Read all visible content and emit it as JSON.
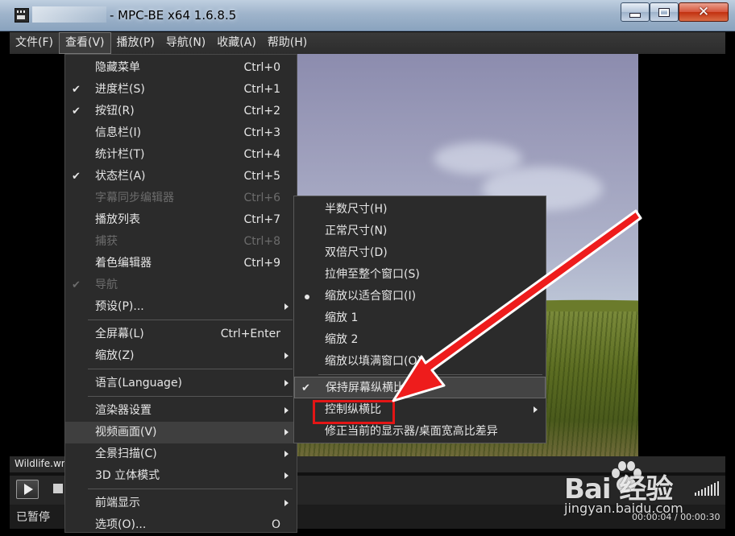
{
  "window": {
    "title": "- MPC-BE x64 1.6.8.5",
    "minimize_glyph": "",
    "close_glyph": "✕"
  },
  "menubar": [
    {
      "label": "文件(F)"
    },
    {
      "label": "查看(V)",
      "active": true
    },
    {
      "label": "播放(P)"
    },
    {
      "label": "导航(N)"
    },
    {
      "label": "收藏(A)"
    },
    {
      "label": "帮助(H)"
    }
  ],
  "view_menu": {
    "items": [
      {
        "label": "隐藏菜单",
        "shortcut": "Ctrl+0",
        "checked": false,
        "enabled": true
      },
      {
        "label": "进度栏(S)",
        "shortcut": "Ctrl+1",
        "checked": true,
        "enabled": true
      },
      {
        "label": "按钮(R)",
        "shortcut": "Ctrl+2",
        "checked": true,
        "enabled": true
      },
      {
        "label": "信息栏(I)",
        "shortcut": "Ctrl+3",
        "checked": false,
        "enabled": true
      },
      {
        "label": "统计栏(T)",
        "shortcut": "Ctrl+4",
        "checked": false,
        "enabled": true
      },
      {
        "label": "状态栏(A)",
        "shortcut": "Ctrl+5",
        "checked": true,
        "enabled": true
      },
      {
        "label": "字幕同步编辑器",
        "shortcut": "Ctrl+6",
        "checked": false,
        "enabled": false
      },
      {
        "label": "播放列表",
        "shortcut": "Ctrl+7",
        "checked": false,
        "enabled": true
      },
      {
        "label": "捕获",
        "shortcut": "Ctrl+8",
        "checked": false,
        "enabled": false
      },
      {
        "label": "着色编辑器",
        "shortcut": "Ctrl+9",
        "checked": false,
        "enabled": true
      },
      {
        "label": "导航",
        "shortcut": "",
        "checked": true,
        "enabled": false
      },
      {
        "label": "预设(P)...",
        "shortcut": "",
        "submenu": true,
        "enabled": true
      },
      {
        "label": "全屏幕(L)",
        "shortcut": "Ctrl+Enter",
        "enabled": true
      },
      {
        "label": "缩放(Z)",
        "shortcut": "",
        "submenu": true,
        "enabled": true
      },
      {
        "label": "语言(Language)",
        "shortcut": "",
        "submenu": true,
        "enabled": true
      },
      {
        "label": "渲染器设置",
        "shortcut": "",
        "submenu": true,
        "enabled": true
      },
      {
        "label": "视频画面(V)",
        "shortcut": "",
        "submenu": true,
        "enabled": true,
        "highlighted": true
      },
      {
        "label": "全景扫描(C)",
        "shortcut": "",
        "submenu": true,
        "enabled": true
      },
      {
        "label": "3D 立体模式",
        "shortcut": "",
        "submenu": true,
        "enabled": true
      },
      {
        "label": "前端显示",
        "shortcut": "",
        "submenu": true,
        "enabled": true
      },
      {
        "label": "选项(O)...",
        "shortcut": "O",
        "enabled": true
      }
    ]
  },
  "video_frame_submenu": {
    "items": [
      {
        "label": "半数尺寸(H)"
      },
      {
        "label": "正常尺寸(N)"
      },
      {
        "label": "双倍尺寸(D)"
      },
      {
        "label": "拉伸至整个窗口(S)"
      },
      {
        "label": "缩放以适合窗口(I)",
        "selected": true
      },
      {
        "label": "缩放 1"
      },
      {
        "label": "缩放 2"
      },
      {
        "label": "缩放以填满窗口(O)"
      },
      {
        "label": "保持屏幕纵横比(K)",
        "checked": true,
        "highlighted": true
      },
      {
        "label": "控制纵横比",
        "submenu": true,
        "annotated": true
      },
      {
        "label": "修正当前的显示器/桌面宽高比差异"
      }
    ]
  },
  "player": {
    "filename": "Wildlife.wmv",
    "status": "已暂停",
    "time": "00:00:04 / 00:00:30"
  },
  "watermark": {
    "logo": "Bai  经验",
    "url": "jingyan.baidu.com"
  },
  "colors": {
    "annotation_red": "#e31515",
    "menu_bg": "#2b2b2b",
    "titlebar": "#9fb4cb"
  }
}
